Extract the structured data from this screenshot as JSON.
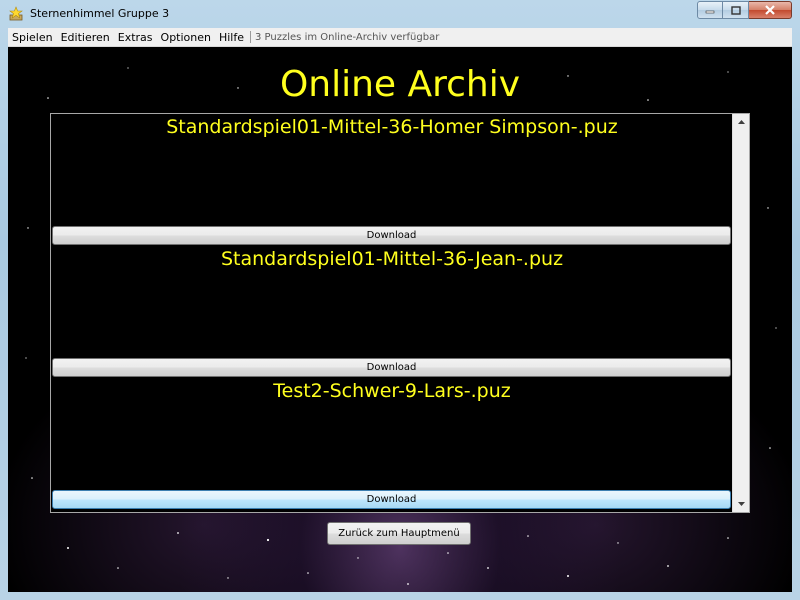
{
  "window": {
    "title": "Sternenhimmel Gruppe 3",
    "icon": "star-app-icon",
    "controls": [
      "minimize",
      "maximize",
      "close"
    ]
  },
  "menubar": {
    "items": [
      "Spielen",
      "Editieren",
      "Extras",
      "Optionen",
      "Hilfe"
    ],
    "status": "3 Puzzles im Online-Archiv verfügbar"
  },
  "page": {
    "title": "Online Archiv"
  },
  "archive": {
    "entries": [
      {
        "name": "Standardspiel01-Mittel-36-Homer Simpson-.puz",
        "button": "Download"
      },
      {
        "name": "Standardspiel01-Mittel-36-Jean-.puz",
        "button": "Download"
      },
      {
        "name": "Test2-Schwer-9-Lars-.puz",
        "button": "Download"
      }
    ]
  },
  "footer": {
    "back_label": "Zurück zum Hauptmenü"
  },
  "colors": {
    "accent_text": "#ffff1e",
    "background": "#000000"
  }
}
